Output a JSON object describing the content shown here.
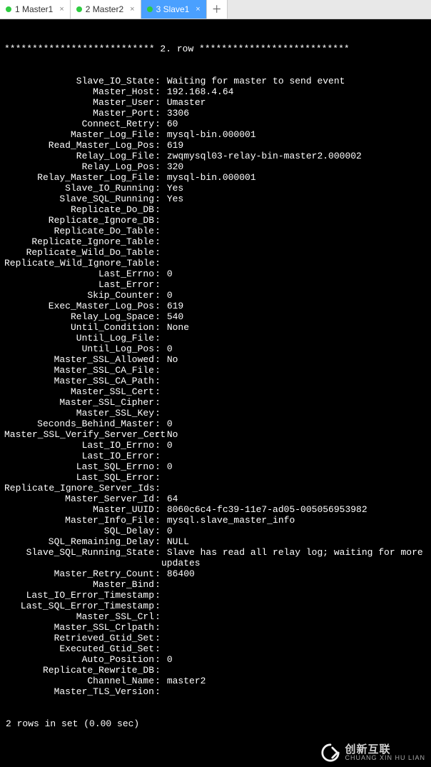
{
  "tabs": {
    "t0": {
      "label": "1 Master1",
      "dotColor": "#2ecc40"
    },
    "t1": {
      "label": "2 Master2",
      "dotColor": "#2ecc40"
    },
    "t2": {
      "label": "3 Slave1",
      "dotColor": "#2ecc40"
    }
  },
  "row_header": "*************************** 2. row ***************************",
  "status": {
    "Slave_IO_State": "Waiting for master to send event",
    "Master_Host": "192.168.4.64",
    "Master_User": "Umaster",
    "Master_Port": "3306",
    "Connect_Retry": "60",
    "Master_Log_File": "mysql-bin.000001",
    "Read_Master_Log_Pos": "619",
    "Relay_Log_File": "zwqmysql03-relay-bin-master2.000002",
    "Relay_Log_Pos": "320",
    "Relay_Master_Log_File": "mysql-bin.000001",
    "Slave_IO_Running": "Yes",
    "Slave_SQL_Running": "Yes",
    "Replicate_Do_DB": "",
    "Replicate_Ignore_DB": "",
    "Replicate_Do_Table": "",
    "Replicate_Ignore_Table": "",
    "Replicate_Wild_Do_Table": "",
    "Replicate_Wild_Ignore_Table": "",
    "Last_Errno": "0",
    "Last_Error": "",
    "Skip_Counter": "0",
    "Exec_Master_Log_Pos": "619",
    "Relay_Log_Space": "540",
    "Until_Condition": "None",
    "Until_Log_File": "",
    "Until_Log_Pos": "0",
    "Master_SSL_Allowed": "No",
    "Master_SSL_CA_File": "",
    "Master_SSL_CA_Path": "",
    "Master_SSL_Cert": "",
    "Master_SSL_Cipher": "",
    "Master_SSL_Key": "",
    "Seconds_Behind_Master": "0",
    "Master_SSL_Verify_Server_Cert": "No",
    "Last_IO_Errno": "0",
    "Last_IO_Error": "",
    "Last_SQL_Errno": "0",
    "Last_SQL_Error": "",
    "Replicate_Ignore_Server_Ids": "",
    "Master_Server_Id": "64",
    "Master_UUID": "8060c6c4-fc39-11e7-ad05-005056953982",
    "Master_Info_File": "mysql.slave_master_info",
    "SQL_Delay": "0",
    "SQL_Remaining_Delay": "NULL",
    "Slave_SQL_Running_State": "Slave has read all relay log; waiting for more updates",
    "Master_Retry_Count": "86400",
    "Master_Bind": "",
    "Last_IO_Error_Timestamp": "",
    "Last_SQL_Error_Timestamp": "",
    "Master_SSL_Crl": "",
    "Master_SSL_Crlpath": "",
    "Retrieved_Gtid_Set": "",
    "Executed_Gtid_Set": "",
    "Auto_Position": "0",
    "Replicate_Rewrite_DB": "",
    "Channel_Name": "master2",
    "Master_TLS_Version": ""
  },
  "status_order": [
    "Slave_IO_State",
    "Master_Host",
    "Master_User",
    "Master_Port",
    "Connect_Retry",
    "Master_Log_File",
    "Read_Master_Log_Pos",
    "Relay_Log_File",
    "Relay_Log_Pos",
    "Relay_Master_Log_File",
    "Slave_IO_Running",
    "Slave_SQL_Running",
    "Replicate_Do_DB",
    "Replicate_Ignore_DB",
    "Replicate_Do_Table",
    "Replicate_Ignore_Table",
    "Replicate_Wild_Do_Table",
    "Replicate_Wild_Ignore_Table",
    "Last_Errno",
    "Last_Error",
    "Skip_Counter",
    "Exec_Master_Log_Pos",
    "Relay_Log_Space",
    "Until_Condition",
    "Until_Log_File",
    "Until_Log_Pos",
    "Master_SSL_Allowed",
    "Master_SSL_CA_File",
    "Master_SSL_CA_Path",
    "Master_SSL_Cert",
    "Master_SSL_Cipher",
    "Master_SSL_Key",
    "Seconds_Behind_Master",
    "Master_SSL_Verify_Server_Cert",
    "Last_IO_Errno",
    "Last_IO_Error",
    "Last_SQL_Errno",
    "Last_SQL_Error",
    "Replicate_Ignore_Server_Ids",
    "Master_Server_Id",
    "Master_UUID",
    "Master_Info_File",
    "SQL_Delay",
    "SQL_Remaining_Delay",
    "Slave_SQL_Running_State",
    "Master_Retry_Count",
    "Master_Bind",
    "Last_IO_Error_Timestamp",
    "Last_SQL_Error_Timestamp",
    "Master_SSL_Crl",
    "Master_SSL_Crlpath",
    "Retrieved_Gtid_Set",
    "Executed_Gtid_Set",
    "Auto_Position",
    "Replicate_Rewrite_DB",
    "Channel_Name",
    "Master_TLS_Version"
  ],
  "footer_text": "2 rows in set (0.00 sec)",
  "watermark": {
    "main": "创新互联",
    "sub": "CHUANG XIN HU LIAN"
  }
}
